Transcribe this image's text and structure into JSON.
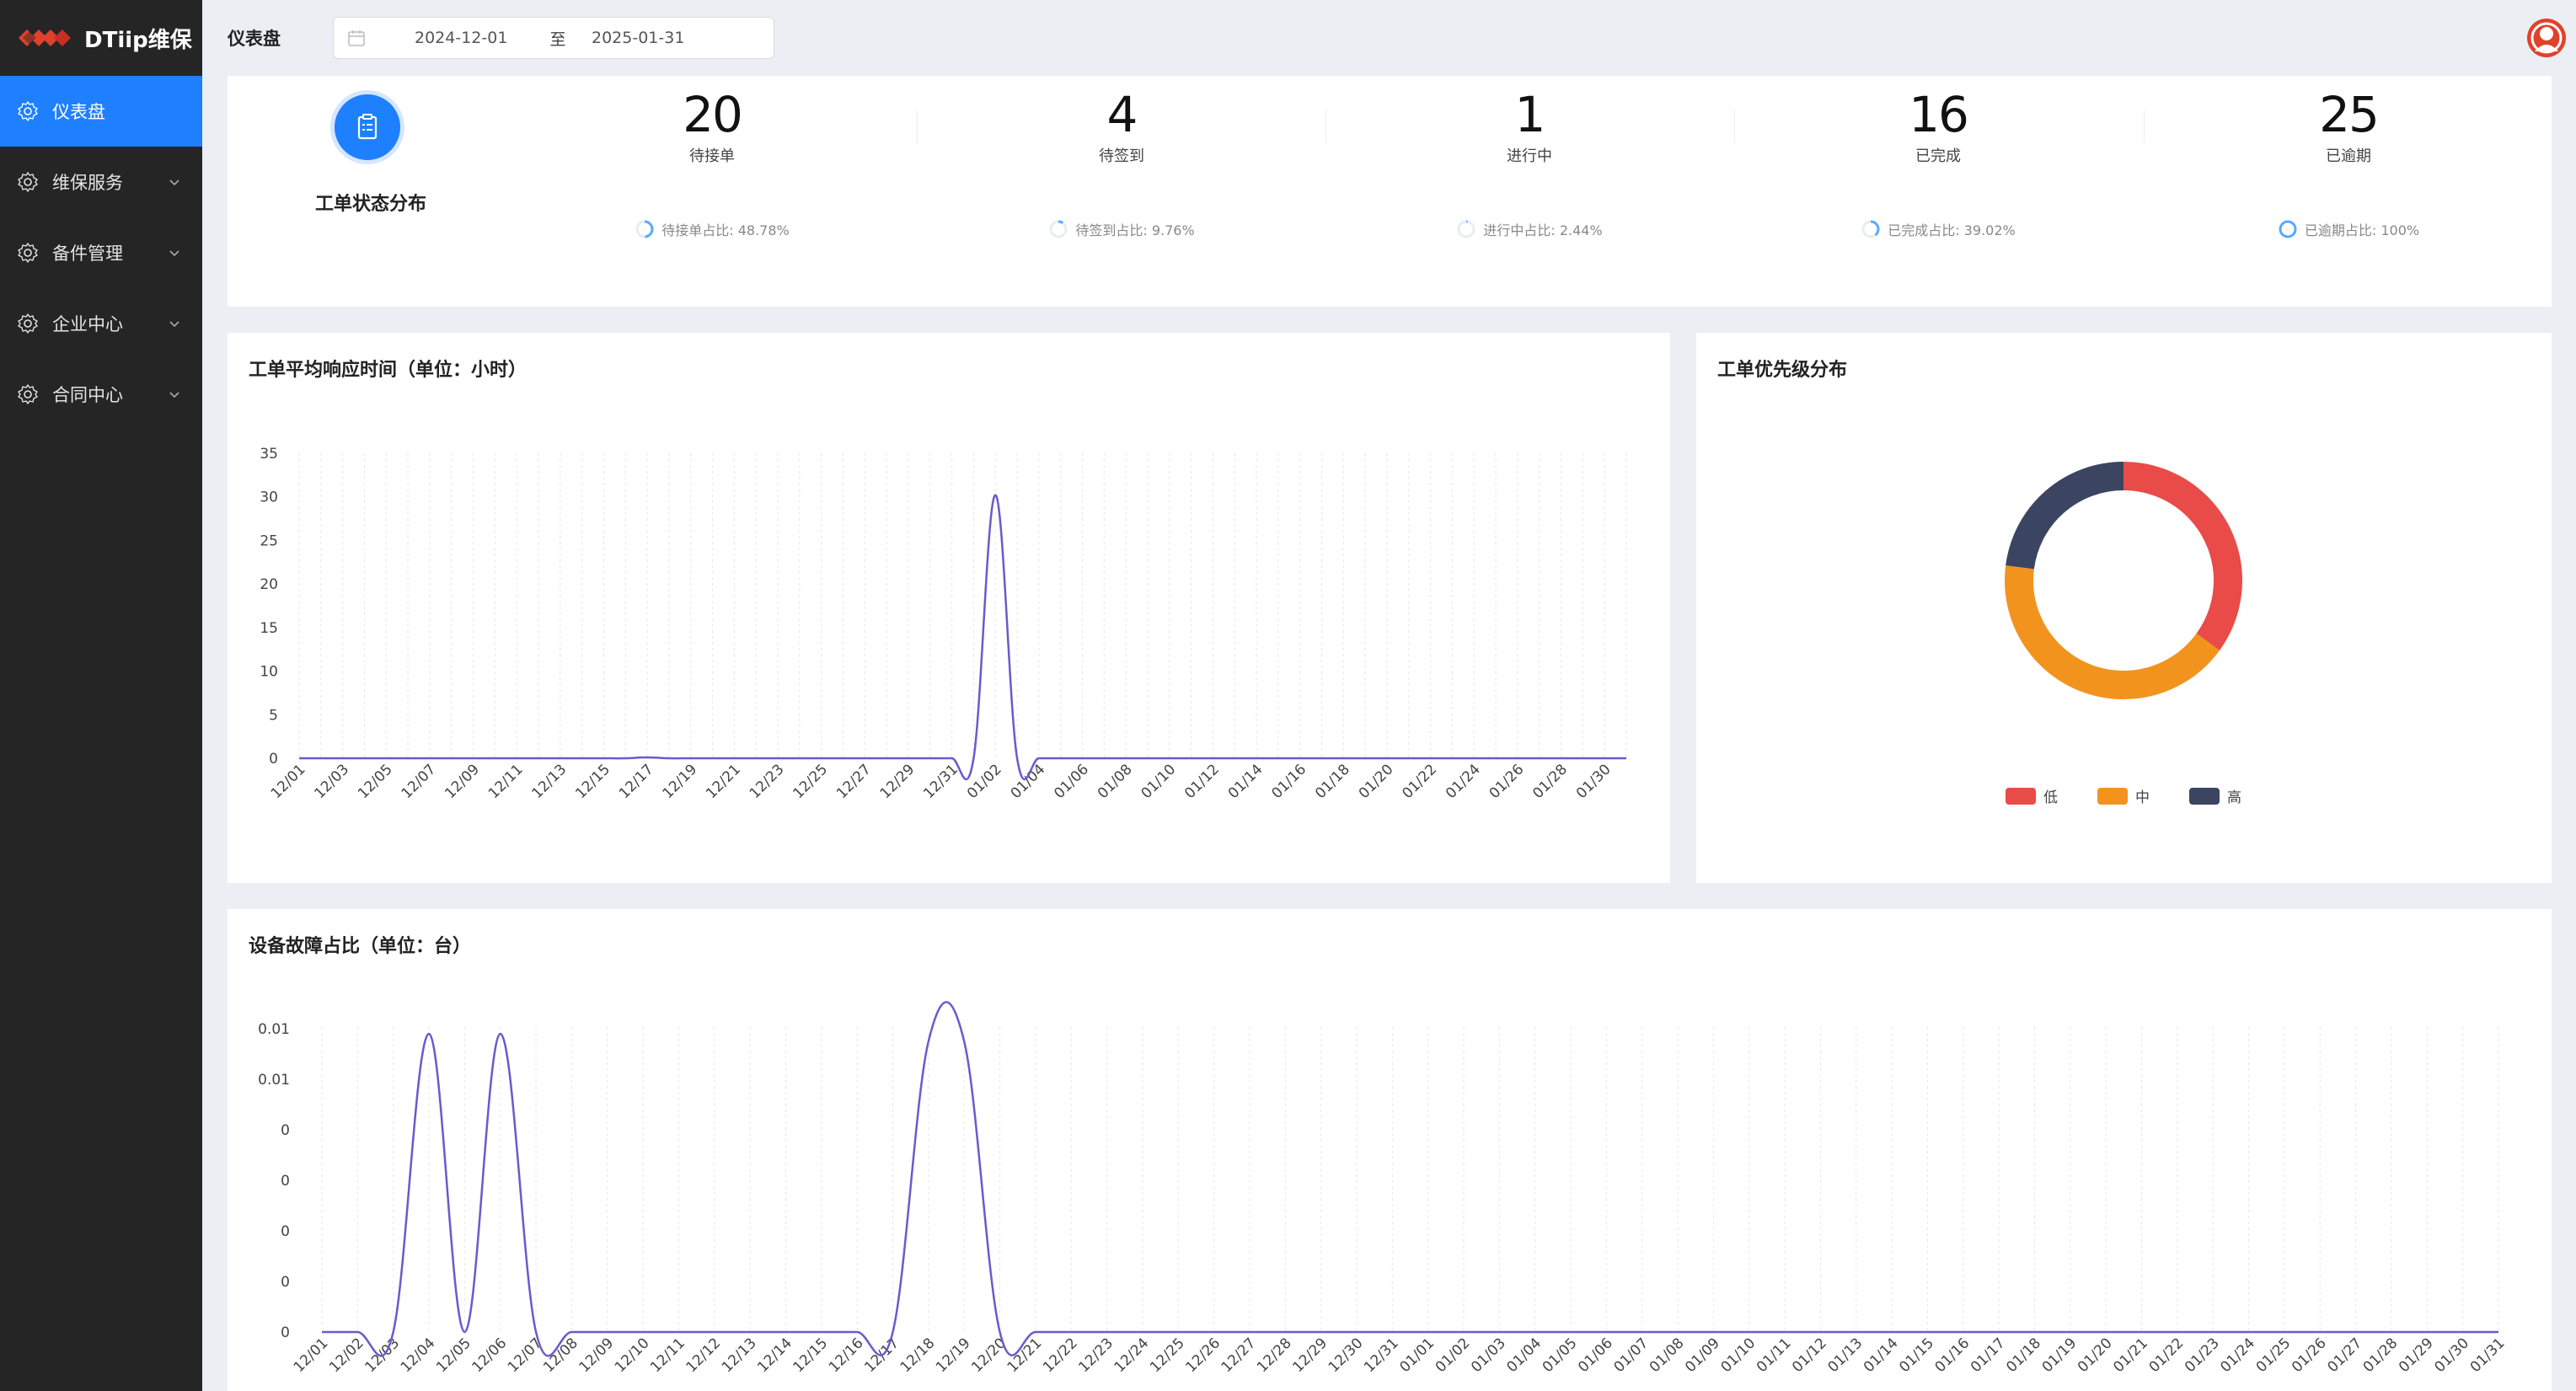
{
  "app": {
    "name": "DTiip维保"
  },
  "sidebar": {
    "items": [
      {
        "label": "仪表盘",
        "active": true
      },
      {
        "label": "维保服务",
        "active": false
      },
      {
        "label": "备件管理",
        "active": false
      },
      {
        "label": "企业中心",
        "active": false
      },
      {
        "label": "合同中心",
        "active": false
      }
    ]
  },
  "header": {
    "title": "仪表盘",
    "date_start": "2024-12-01",
    "date_sep": "至",
    "date_end": "2025-01-31"
  },
  "colors": {
    "primary": "#1e80ff",
    "line": "#6a5acd",
    "low": "#e94b48",
    "medium": "#f2931e",
    "high": "#3b4460"
  },
  "status": {
    "title": "工单状态分布",
    "stats": [
      {
        "value": "20",
        "label": "待接单",
        "pct_text": "待接单占比: 48.78%",
        "pct": 48.78
      },
      {
        "value": "4",
        "label": "待签到",
        "pct_text": "待签到占比: 9.76%",
        "pct": 9.76
      },
      {
        "value": "1",
        "label": "进行中",
        "pct_text": "进行中占比: 2.44%",
        "pct": 2.44
      },
      {
        "value": "16",
        "label": "已完成",
        "pct_text": "已完成占比: 39.02%",
        "pct": 39.02
      },
      {
        "value": "25",
        "label": "已逾期",
        "pct_text": "已逾期占比: 100%",
        "pct": 100
      }
    ]
  },
  "response_chart": {
    "title": "工单平均响应时间（单位：小时）",
    "chart_data": {
      "type": "line",
      "x": [
        "12/01",
        "12/02",
        "12/03",
        "12/04",
        "12/05",
        "12/06",
        "12/07",
        "12/08",
        "12/09",
        "12/10",
        "12/11",
        "12/12",
        "12/13",
        "12/14",
        "12/15",
        "12/16",
        "12/17",
        "12/18",
        "12/19",
        "12/20",
        "12/21",
        "12/22",
        "12/23",
        "12/24",
        "12/25",
        "12/26",
        "12/27",
        "12/28",
        "12/29",
        "12/30",
        "12/31",
        "01/01",
        "01/02",
        "01/03",
        "01/04",
        "01/05",
        "01/06",
        "01/07",
        "01/08",
        "01/09",
        "01/10",
        "01/11",
        "01/12",
        "01/13",
        "01/14",
        "01/15",
        "01/16",
        "01/17",
        "01/18",
        "01/19",
        "01/20",
        "01/21",
        "01/22",
        "01/23",
        "01/24",
        "01/25",
        "01/26",
        "01/27",
        "01/28",
        "01/29",
        "01/30",
        "01/31"
      ],
      "x_tick_labels": [
        "12/01",
        "12/03",
        "12/05",
        "12/07",
        "12/09",
        "12/11",
        "12/13",
        "12/15",
        "12/17",
        "12/19",
        "12/21",
        "12/23",
        "12/25",
        "12/27",
        "12/29",
        "12/31",
        "01/02",
        "01/04",
        "01/06",
        "01/08",
        "01/10",
        "01/12",
        "01/14",
        "01/16",
        "01/18",
        "01/20",
        "01/22",
        "01/24",
        "01/26",
        "01/28",
        "01/30"
      ],
      "values": [
        0,
        0,
        0,
        0,
        0,
        0,
        0,
        0,
        0,
        0,
        0,
        0,
        0,
        0,
        0,
        0,
        0.1,
        0,
        0,
        0,
        0,
        0,
        0,
        0,
        0,
        0,
        0,
        0,
        0,
        0,
        0,
        0,
        30.2,
        0,
        0,
        0,
        0,
        0,
        0,
        0,
        0,
        0,
        0,
        0,
        0,
        0,
        0,
        0,
        0,
        0,
        0,
        0,
        0,
        0,
        0,
        0,
        0,
        0,
        0,
        0,
        0,
        0
      ],
      "ylim": [
        0,
        35
      ],
      "y_ticks": [
        0,
        5,
        10,
        15,
        20,
        25,
        30,
        35
      ]
    }
  },
  "priority_chart": {
    "title": "工单优先级分布",
    "chart_data": {
      "type": "pie",
      "labels": [
        "低",
        "中",
        "高"
      ],
      "values": [
        35,
        42,
        23
      ],
      "colors": [
        "#e94b48",
        "#f2931e",
        "#3b4460"
      ]
    }
  },
  "fault_chart": {
    "title": "设备故障占比（单位：台）",
    "chart_data": {
      "type": "line",
      "x": [
        "12/01",
        "12/02",
        "12/03",
        "12/04",
        "12/05",
        "12/06",
        "12/07",
        "12/08",
        "12/09",
        "12/10",
        "12/11",
        "12/12",
        "12/13",
        "12/14",
        "12/15",
        "12/16",
        "12/17",
        "12/18",
        "12/19",
        "12/20",
        "12/21",
        "12/22",
        "12/23",
        "12/24",
        "12/25",
        "12/26",
        "12/27",
        "12/28",
        "12/29",
        "12/30",
        "12/31",
        "01/01",
        "01/02",
        "01/03",
        "01/04",
        "01/05",
        "01/06",
        "01/07",
        "01/08",
        "01/09",
        "01/10",
        "01/11",
        "01/12",
        "01/13",
        "01/14",
        "01/15",
        "01/16",
        "01/17",
        "01/18",
        "01/19",
        "01/20",
        "01/21",
        "01/22",
        "01/23",
        "01/24",
        "01/25",
        "01/26",
        "01/27",
        "01/28",
        "01/29",
        "01/30",
        "01/31"
      ],
      "values": [
        0,
        0,
        0,
        0.0118,
        0,
        0.0118,
        0,
        0,
        0,
        0,
        0,
        0,
        0,
        0,
        0,
        0,
        0,
        0.0115,
        0.0115,
        0,
        0,
        0,
        0,
        0,
        0,
        0,
        0,
        0,
        0,
        0,
        0,
        0,
        0,
        0,
        0,
        0,
        0,
        0,
        0,
        0,
        0,
        0,
        0,
        0,
        0,
        0,
        0,
        0,
        0,
        0,
        0,
        0,
        0,
        0,
        0,
        0,
        0,
        0,
        0,
        0,
        0,
        0
      ],
      "ylim": [
        0,
        0.012
      ],
      "y_tick_labels": [
        "0",
        "0",
        "0",
        "0",
        "0",
        "0.01",
        "0.01"
      ]
    }
  }
}
